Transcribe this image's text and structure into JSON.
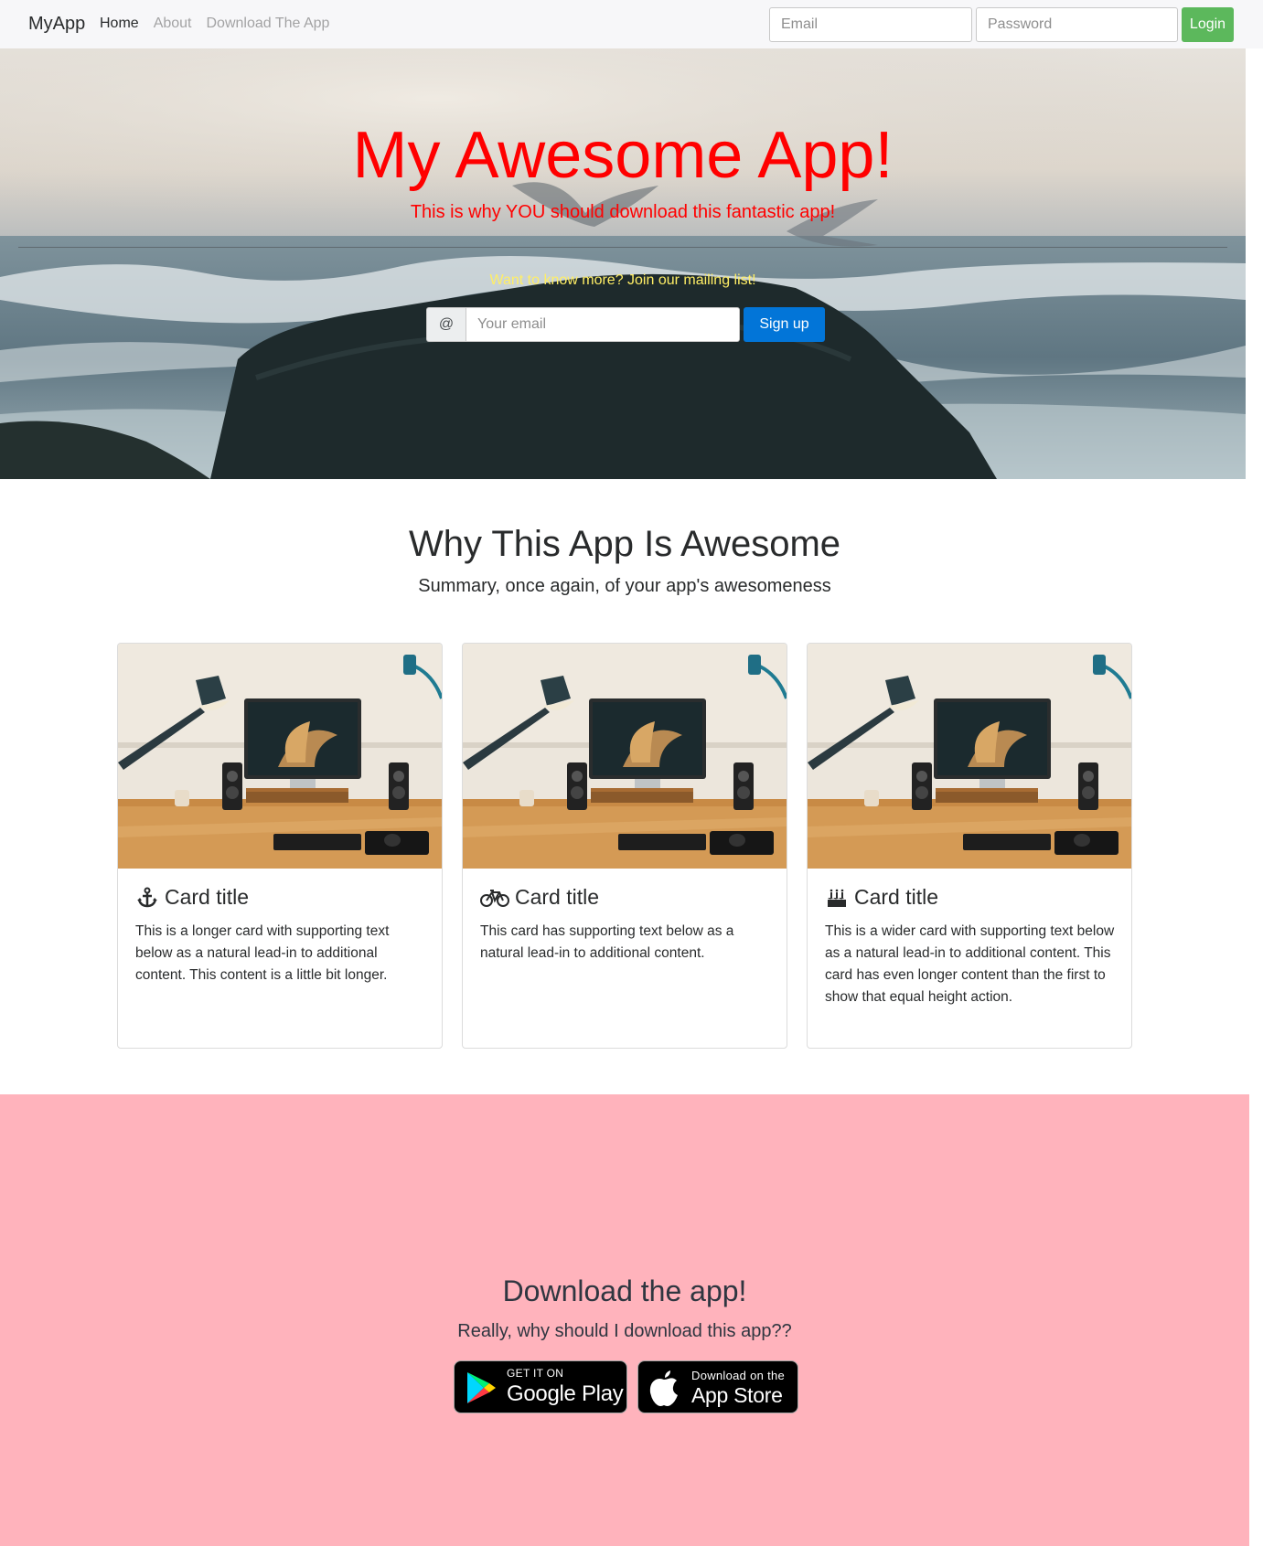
{
  "nav": {
    "brand": "MyApp",
    "links": [
      "Home",
      "About",
      "Download The App"
    ],
    "email_placeholder": "Email",
    "password_placeholder": "Password",
    "login_label": "Login"
  },
  "hero": {
    "title": "My Awesome App!",
    "subtitle": "This is why YOU should download this fantastic app!",
    "mailing_text": "Want to know more? Join our mailing list!",
    "at_symbol": "@",
    "email_placeholder": "Your email",
    "signup_label": "Sign up"
  },
  "features": {
    "title": "Why This App Is Awesome",
    "subtitle": "Summary, once again, of your app's awesomeness",
    "cards": [
      {
        "icon": "anchor-icon",
        "title": "Card title",
        "text": "This is a longer card with supporting text below as a natural lead-in to additional content. This content is a little bit longer."
      },
      {
        "icon": "bicycle-icon",
        "title": "Card title",
        "text": "This card has supporting text below as a natural lead-in to additional content."
      },
      {
        "icon": "birthday-cake-icon",
        "title": "Card title",
        "text": "This is a wider card with supporting text below as a natural lead-in to additional content. This card has even longer content than the first to show that equal height action."
      }
    ]
  },
  "download": {
    "title": "Download the app!",
    "subtitle": "Really, why should I download this app??",
    "google_play": {
      "small": "GET IT ON",
      "big": "Google Play"
    },
    "app_store": {
      "small": "Download on the",
      "big": "App Store"
    }
  },
  "colors": {
    "hero_title": "#ff0000",
    "mailing_text": "#ffee66",
    "login_button": "#5cb85c",
    "signup_button": "#0275d8",
    "download_background": "#ffb3bc"
  }
}
